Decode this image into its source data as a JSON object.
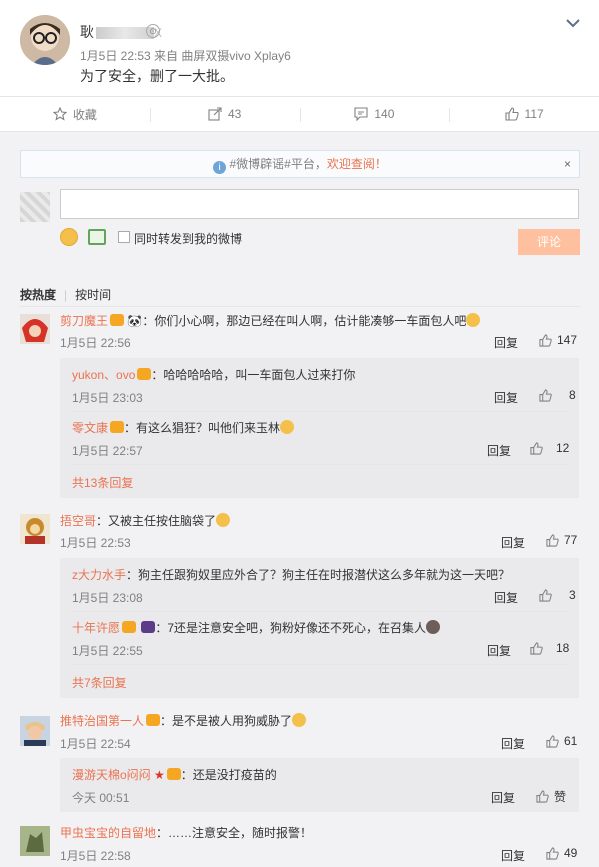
{
  "post": {
    "author": "耿",
    "author_suffix": "X",
    "meta": "1月5日 22:53 来自 曲屏双摄vivo Xplay6",
    "text": "为了安全，删了一大批。"
  },
  "actions": [
    {
      "icon": "star-icon",
      "label": "收藏"
    },
    {
      "icon": "share-icon",
      "label": "43"
    },
    {
      "icon": "comment-icon",
      "label": "140"
    },
    {
      "icon": "thumbs-up-icon",
      "label": "117"
    }
  ],
  "notice": {
    "prefix": "#微博辟谣#平台，",
    "highlight": "欢迎查阅！",
    "close": "×"
  },
  "composer": {
    "checkbox_label": "同时转发到我的微博",
    "submit_label": "评论"
  },
  "sort": {
    "hot": "按热度",
    "time": "按时间"
  },
  "comments": [
    {
      "nick": "剪刀魔王",
      "text": "：你们小心啊，那边已经在叫人啊，估计能凑够一车面包人吧",
      "time": "1月5日 22:56",
      "reply": "回复",
      "likes": "147",
      "replies": [
        {
          "nick": "yukon、ovo",
          "text": "：哈哈哈哈哈，叫一车面包人过来打你",
          "time": "1月5日 23:03",
          "reply": "回复",
          "likes": "8"
        },
        {
          "nick": "零文康",
          "text": "：有这么猖狂？叫他们来玉林",
          "time": "1月5日 22:57",
          "reply": "回复",
          "likes": "12"
        }
      ],
      "more": "共13条回复"
    },
    {
      "nick": "捂空哥",
      "text": "：又被主任按住脑袋了",
      "time": "1月5日 22:53",
      "reply": "回复",
      "likes": "77",
      "replies": [
        {
          "nick": "z大力水手",
          "text": "：狗主任跟狗奴里应外合了？狗主任在时报潜伏这么多年就为这一天吧？",
          "time": "1月5日 23:08",
          "reply": "回复",
          "likes": "3"
        },
        {
          "nick": "十年许愿",
          "text": "：7还是注意安全吧，狗粉好像还不死心，在召集人",
          "time": "1月5日 22:55",
          "reply": "回复",
          "likes": "18"
        }
      ],
      "more": "共7条回复"
    },
    {
      "nick": "推特治国第一人",
      "text": "：是不是被人用狗威胁了",
      "time": "1月5日 22:54",
      "reply": "回复",
      "likes": "61",
      "replies": [
        {
          "nick": "漫游天棉o闷闷",
          "text": "：还是没打疫苗的",
          "time": "今天 00:51",
          "reply": "回复",
          "likes": "赞"
        }
      ]
    },
    {
      "nick": "甲虫宝宝的自留地",
      "text": "：……注意安全，随时报警！",
      "time": "1月5日 22:58",
      "reply": "回复",
      "likes": "49"
    }
  ]
}
